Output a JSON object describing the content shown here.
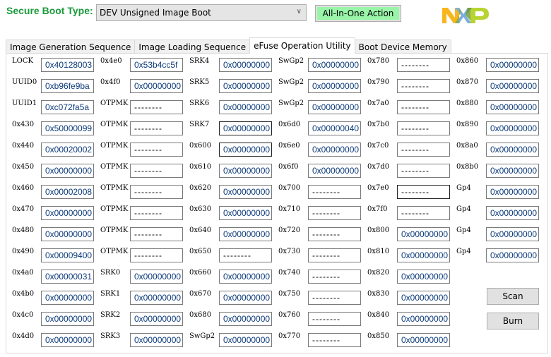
{
  "header": {
    "boot_type_label": "Secure Boot Type:",
    "boot_type_value": "DEV Unsigned Image Boot",
    "all_in_one_label": "All-In-One Action",
    "logo": "NXP"
  },
  "tabs": [
    {
      "label": "Image Generation Sequence",
      "active": false
    },
    {
      "label": "Image Loading Sequence",
      "active": false
    },
    {
      "label": "eFuse Operation Utility",
      "active": true
    },
    {
      "label": "Boot Device Memory",
      "active": false
    }
  ],
  "columns": [
    [
      {
        "label": "LOCK",
        "value": "0x40128003"
      },
      {
        "label": "UUID0",
        "value": "0xb96fe9ba"
      },
      {
        "label": "UUID1",
        "value": "0xc072fa5a"
      },
      {
        "label": "0x430",
        "value": "0x50000099"
      },
      {
        "label": "0x440",
        "value": "0x00020002"
      },
      {
        "label": "0x450",
        "value": "0x00000000"
      },
      {
        "label": "0x460",
        "value": "0x00002008"
      },
      {
        "label": "0x470",
        "value": "0x00000000"
      },
      {
        "label": "0x480",
        "value": "0x00000000"
      },
      {
        "label": "0x490",
        "value": "0x00009400"
      },
      {
        "label": "0x4a0",
        "value": "0x00000031"
      },
      {
        "label": "0x4b0",
        "value": "0x00000000"
      },
      {
        "label": "0x4c0",
        "value": "0x00000000"
      },
      {
        "label": "0x4d0",
        "value": "0x00000000"
      }
    ],
    [
      {
        "label": "0x4e0",
        "value": "0x53b4cc5f"
      },
      {
        "label": "0x4f0",
        "value": "0x00000000"
      },
      {
        "label": "OTPMK",
        "value": "--------"
      },
      {
        "label": "OTPMK",
        "value": "--------"
      },
      {
        "label": "OTPMK",
        "value": "--------"
      },
      {
        "label": "OTPMK",
        "value": "--------"
      },
      {
        "label": "OTPMK",
        "value": "--------"
      },
      {
        "label": "OTPMK",
        "value": "--------"
      },
      {
        "label": "OTPMK",
        "value": "--------"
      },
      {
        "label": "OTPMK",
        "value": "--------"
      },
      {
        "label": "SRK0",
        "value": "0x00000000"
      },
      {
        "label": "SRK1",
        "value": "0x00000000"
      },
      {
        "label": "SRK2",
        "value": "0x00000000"
      },
      {
        "label": "SRK3",
        "value": "0x00000000"
      }
    ],
    [
      {
        "label": "SRK4",
        "value": "0x00000000"
      },
      {
        "label": "SRK5",
        "value": "0x00000000"
      },
      {
        "label": "SRK6",
        "value": "0x00000000"
      },
      {
        "label": "SRK7",
        "value": "0x00000000"
      },
      {
        "label": "0x600",
        "value": "0x00000000"
      },
      {
        "label": "0x610",
        "value": "0x00000000"
      },
      {
        "label": "0x620",
        "value": "0x00000000"
      },
      {
        "label": "0x630",
        "value": "0x00000000"
      },
      {
        "label": "0x640",
        "value": "0x00000000"
      },
      {
        "label": "0x650",
        "value": "--------"
      },
      {
        "label": "0x660",
        "value": "0x00000000"
      },
      {
        "label": "0x670",
        "value": "0x00000000"
      },
      {
        "label": "0x680",
        "value": "0x00000000"
      },
      {
        "label": "SwGp2",
        "value": "0x00000000"
      }
    ],
    [
      {
        "label": "SwGp2",
        "value": "0x00000000"
      },
      {
        "label": "SwGp2",
        "value": "0x00000000"
      },
      {
        "label": "SwGp2",
        "value": "0x00000000"
      },
      {
        "label": "0x6d0",
        "value": "0x00000040"
      },
      {
        "label": "0x6e0",
        "value": "0x00000000"
      },
      {
        "label": "0x6f0",
        "value": "0x00000000"
      },
      {
        "label": "0x700",
        "value": "--------"
      },
      {
        "label": "0x710",
        "value": "--------"
      },
      {
        "label": "0x720",
        "value": "--------"
      },
      {
        "label": "0x730",
        "value": "--------"
      },
      {
        "label": "0x740",
        "value": "--------"
      },
      {
        "label": "0x750",
        "value": "--------"
      },
      {
        "label": "0x760",
        "value": "--------"
      },
      {
        "label": "0x770",
        "value": "--------"
      }
    ],
    [
      {
        "label": "0x780",
        "value": "--------"
      },
      {
        "label": "0x790",
        "value": "--------"
      },
      {
        "label": "0x7a0",
        "value": "--------"
      },
      {
        "label": "0x7b0",
        "value": "--------"
      },
      {
        "label": "0x7c0",
        "value": "--------"
      },
      {
        "label": "0x7d0",
        "value": "--------"
      },
      {
        "label": "0x7e0",
        "value": "--------"
      },
      {
        "label": "0x7f0",
        "value": "--------"
      },
      {
        "label": "0x800",
        "value": "0x00000000"
      },
      {
        "label": "0x810",
        "value": "0x00000000"
      },
      {
        "label": "0x820",
        "value": "0x00000000"
      },
      {
        "label": "0x830",
        "value": "0x00000000"
      },
      {
        "label": "0x840",
        "value": "0x00000000"
      },
      {
        "label": "0x850",
        "value": "0x00000000"
      }
    ],
    [
      {
        "label": "0x860",
        "value": "0x00000000"
      },
      {
        "label": "0x870",
        "value": "0x00000000"
      },
      {
        "label": "0x880",
        "value": "0x00000000"
      },
      {
        "label": "0x890",
        "value": "0x00000000"
      },
      {
        "label": "0x8a0",
        "value": "0x00000000"
      },
      {
        "label": "0x8b0",
        "value": "0x00000000"
      },
      {
        "label": "Gp4",
        "value": "0x00000000"
      },
      {
        "label": "Gp4",
        "value": "0x00000000"
      },
      {
        "label": "Gp4",
        "value": "0x00000000"
      },
      {
        "label": "Gp4",
        "value": "0x00000000"
      }
    ]
  ],
  "buttons": {
    "scan": "Scan",
    "burn": "Burn"
  }
}
